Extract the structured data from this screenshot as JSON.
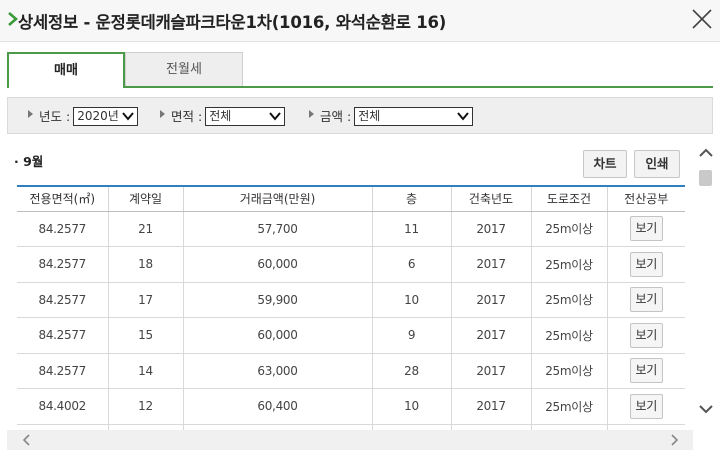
{
  "header": {
    "title": "상세정보 - 운정롯데캐슬파크타운1차(1016, 와석순환로 16)"
  },
  "tabs": [
    {
      "label": "매매",
      "active": true
    },
    {
      "label": "전월세",
      "active": false
    }
  ],
  "filters": {
    "year": {
      "label": "년도 :",
      "value": "2020년"
    },
    "area": {
      "label": "면적 :",
      "value": "전체"
    },
    "price": {
      "label": "금액 :",
      "value": "전체"
    }
  },
  "section": {
    "month": "· 9월",
    "chart_button": "차트",
    "print_button": "인쇄"
  },
  "table": {
    "headers": [
      "전용면적(㎡)",
      "계약일",
      "거래금액(만원)",
      "층",
      "건축년도",
      "도로조건",
      "전산공부"
    ],
    "view_label": "보기",
    "rows": [
      {
        "area": "84.2577",
        "day": "21",
        "price": "57,700",
        "floor": "11",
        "year": "2017",
        "road": "25m이상"
      },
      {
        "area": "84.2577",
        "day": "18",
        "price": "60,000",
        "floor": "6",
        "year": "2017",
        "road": "25m이상"
      },
      {
        "area": "84.2577",
        "day": "17",
        "price": "59,900",
        "floor": "10",
        "year": "2017",
        "road": "25m이상"
      },
      {
        "area": "84.2577",
        "day": "15",
        "price": "60,000",
        "floor": "9",
        "year": "2017",
        "road": "25m이상"
      },
      {
        "area": "84.2577",
        "day": "14",
        "price": "63,000",
        "floor": "28",
        "year": "2017",
        "road": "25m이상"
      },
      {
        "area": "84.4002",
        "day": "12",
        "price": "60,400",
        "floor": "10",
        "year": "2017",
        "road": "25m이상"
      }
    ]
  },
  "colors": {
    "tab_accent": "#4a9a4a",
    "table_header_rule": "#2f7fc1",
    "title_chevron": "#3a9a3a"
  },
  "icons": {
    "title_marker": "chevron-right-icon",
    "close": "close-icon",
    "select_arrow": "chevron-down-icon",
    "scroll_up": "chevron-up-icon",
    "scroll_down": "chevron-down-icon",
    "scroll_left": "chevron-left-icon",
    "scroll_right": "chevron-right-icon"
  }
}
